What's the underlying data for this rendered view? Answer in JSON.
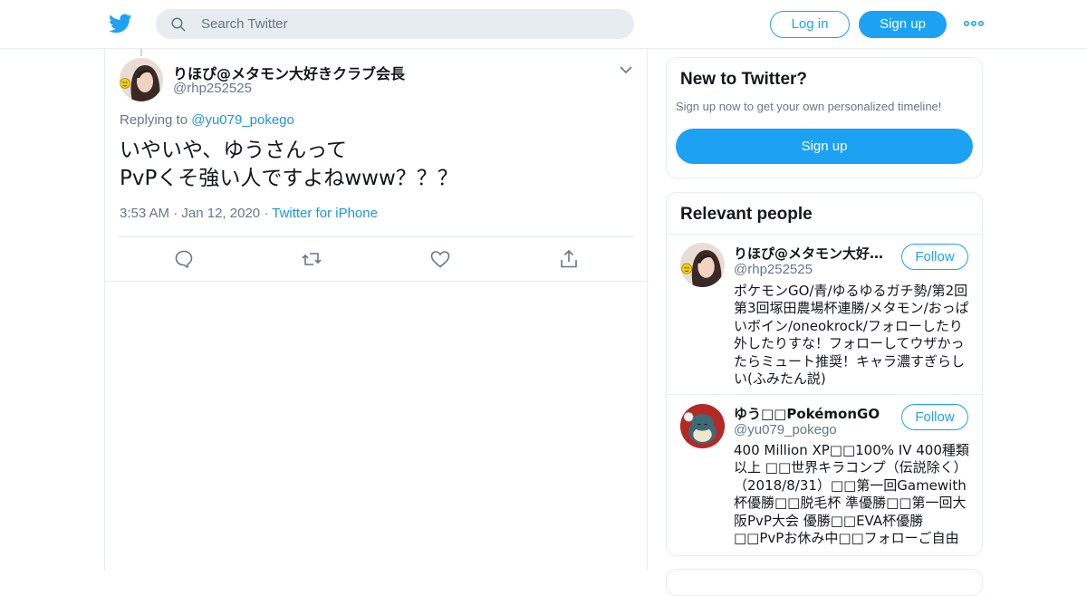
{
  "header": {
    "search_placeholder": "Search Twitter",
    "login_label": "Log in",
    "signup_label": "Sign up",
    "brand_color": "#1da1f2"
  },
  "tweet": {
    "display_name": "りほぴ@メタモン大好きクラブ会長",
    "handle": "@rhp252525",
    "replying_prefix": "Replying to ",
    "replying_to": "@yu079_pokego",
    "text_line1": "いやいや、ゆうさんって",
    "text_line2": "PvPくそ強い人ですよねwww？？？",
    "time": "3:53 AM",
    "date": "Jan 12, 2020",
    "source": "Twitter for iPhone",
    "dot": "·"
  },
  "sidebar": {
    "new_title": "New to Twitter?",
    "new_sub": "Sign up now to get your own personalized timeline!",
    "new_signup_label": "Sign up",
    "relevant_title": "Relevant people",
    "people": [
      {
        "name": "りほぴ@メタモン大好きクラブ会長",
        "handle": "@rhp252525",
        "follow_label": "Follow",
        "bio": "ポケモンGO/青/ゆるゆるガチ勢/第2回第3回塚田農場杯連勝/メタモン/おっぱいボイン/oneokrock/フォローしたり外したりすな！フォローしてウザかったらミュート推奨！キャラ濃すぎらしい(ふみたん説)"
      },
      {
        "name": "ゆう□□PokémonGO",
        "handle": "@yu079_pokego",
        "follow_label": "Follow",
        "bio": "400 Million XP□□100% IV 400種類以上 □□世界キラコンプ（伝説除く）（2018/8/31）□□第一回Gamewith杯優勝□□脱毛杯 準優勝□□第一回大阪PvP大会 優勝□□EVA杯優勝□□PvPお休み中□□フォローご自由に"
      }
    ]
  }
}
